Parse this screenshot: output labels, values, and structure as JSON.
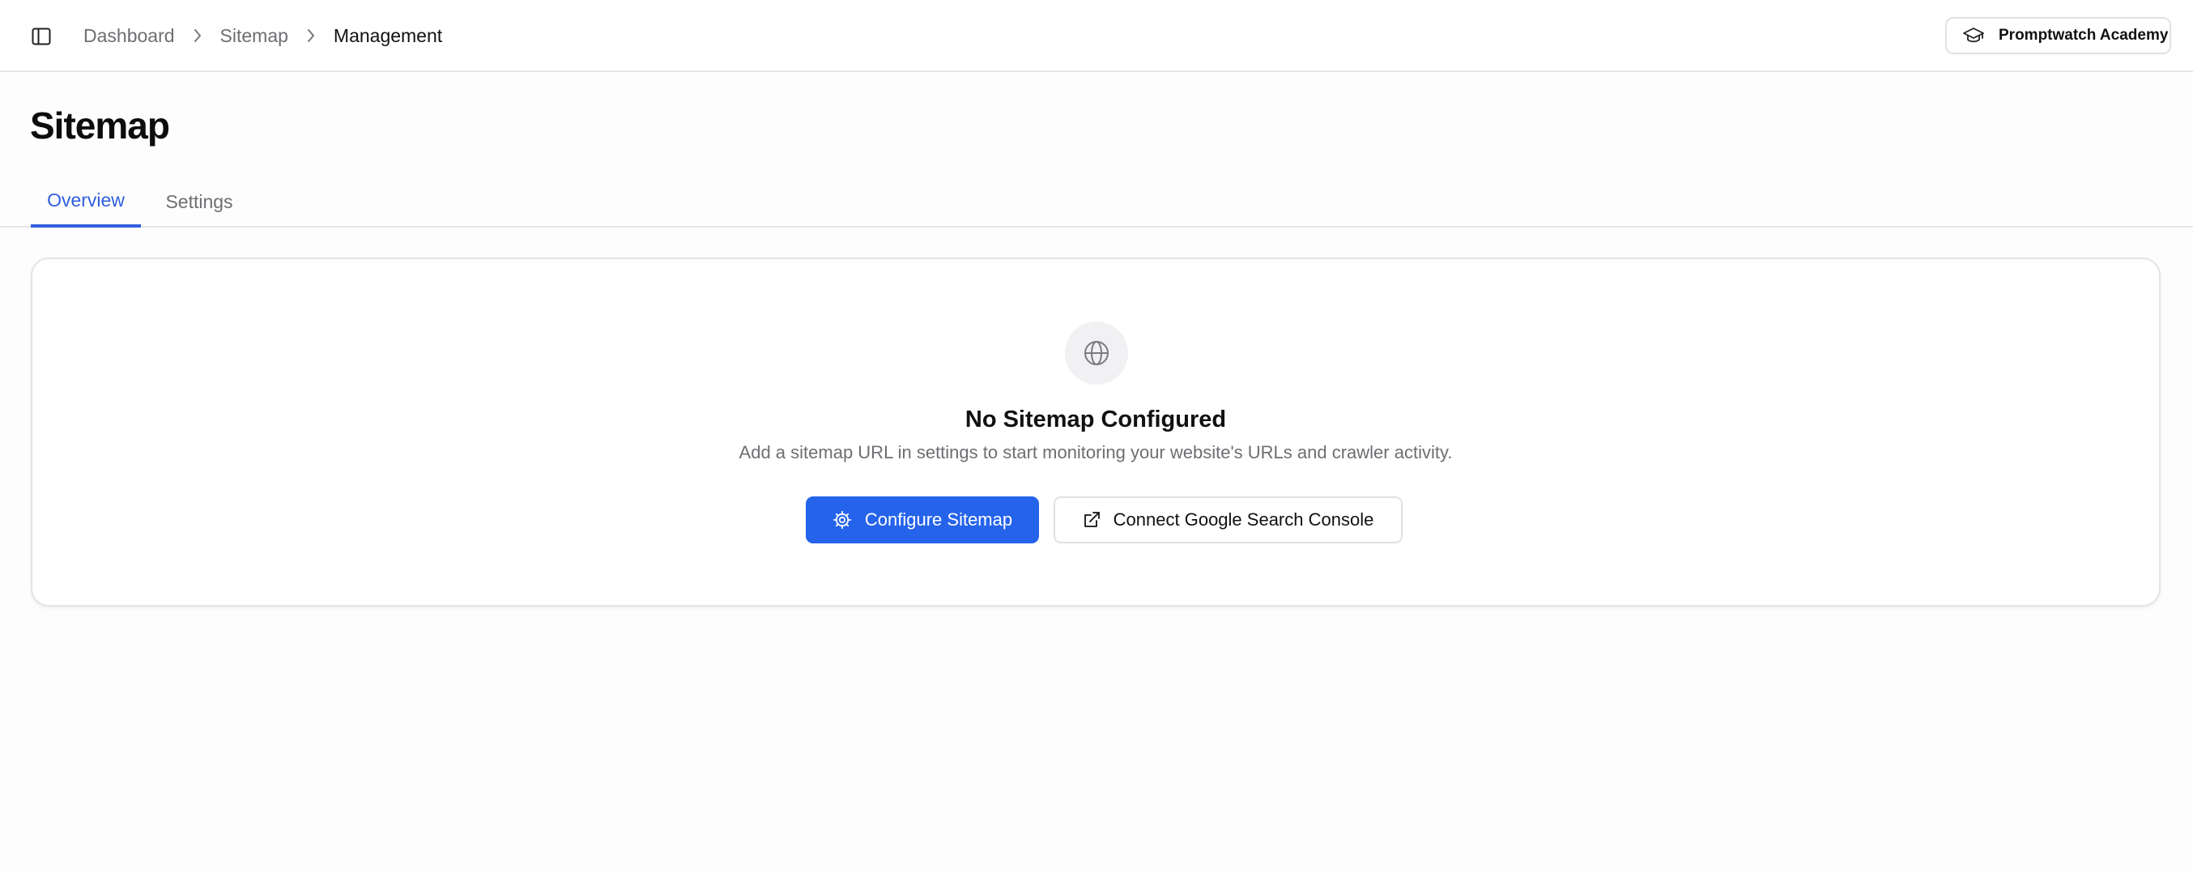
{
  "header": {
    "breadcrumb": [
      "Dashboard",
      "Sitemap",
      "Management"
    ],
    "academy_label": "Promptwatch Academy"
  },
  "page": {
    "title": "Sitemap",
    "tabs": [
      {
        "label": "Overview",
        "active": true
      },
      {
        "label": "Settings",
        "active": false
      }
    ]
  },
  "empty_state": {
    "icon": "globe-icon",
    "title": "No Sitemap Configured",
    "description": "Add a sitemap URL in settings to start monitoring your website's URLs and crawler activity.",
    "primary_button": "Configure Sitemap",
    "secondary_button": "Connect Google Search Console"
  },
  "colors": {
    "accent": "#2563eb",
    "tab_active": "#2f5fe0",
    "muted_text": "#6e6e73"
  }
}
